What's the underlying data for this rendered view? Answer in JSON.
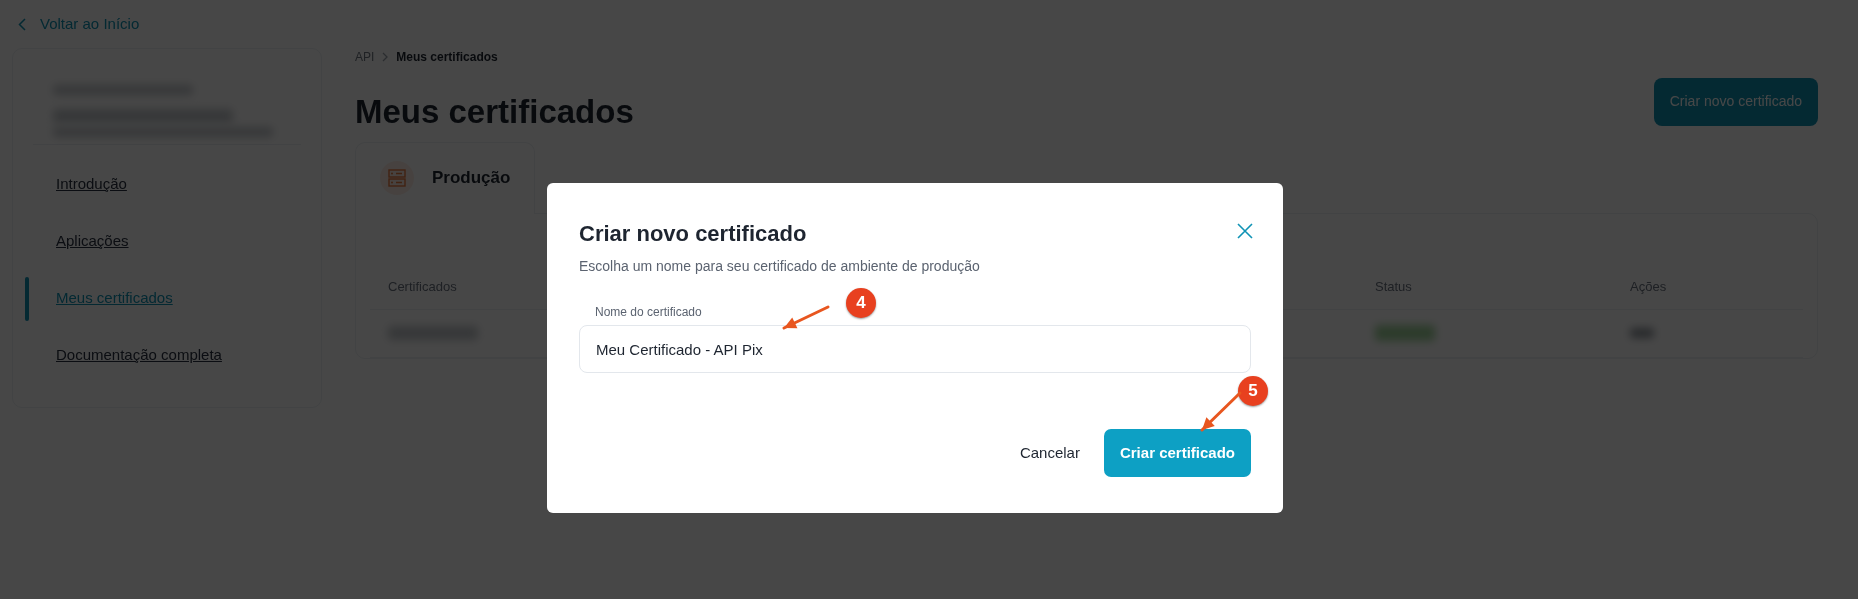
{
  "back_link": "Voltar ao Início",
  "sidebar": {
    "items": [
      {
        "label": "Introdução",
        "selected": false
      },
      {
        "label": "Aplicações",
        "selected": false
      },
      {
        "label": "Meus certificados",
        "selected": true
      },
      {
        "label": "Documentação completa",
        "selected": false
      }
    ]
  },
  "breadcrumb": [
    {
      "label": "API",
      "current": false
    },
    {
      "label": "Meus certificados",
      "current": true
    }
  ],
  "page_title": "Meus certificados",
  "primary_button": "Criar novo certificado",
  "tabs": [
    {
      "label": "Produção",
      "selected": true
    }
  ],
  "table": {
    "columns": [
      "Certificados",
      "Status",
      "Ações"
    ]
  },
  "modal": {
    "title": "Criar novo certificado",
    "subtitle": "Escolha um nome para seu certificado de ambiente de produção",
    "field": {
      "label": "Nome do certificado",
      "value": "Meu Certificado - API Pix"
    },
    "cancel_button": "Cancelar",
    "confirm_button": "Criar certificado"
  },
  "annotations": [
    {
      "number": "4"
    },
    {
      "number": "5"
    }
  ]
}
